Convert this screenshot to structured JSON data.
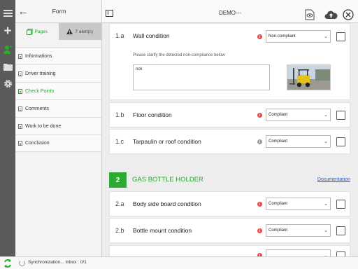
{
  "sidebar": {
    "title": "Form",
    "tabs": {
      "pages": "Pages",
      "alerts": "7 alert(s)"
    },
    "items": [
      {
        "label": "Informations"
      },
      {
        "label": "Driver training"
      },
      {
        "label": "Check Points"
      },
      {
        "label": "Comments"
      },
      {
        "label": "Work to be done"
      },
      {
        "label": "Conclusion"
      }
    ]
  },
  "header": {
    "title": "DEMO---"
  },
  "questions": [
    {
      "num": "1.a",
      "label": "Wall condition",
      "value": "Non-compliant"
    },
    {
      "num": "1.b",
      "label": "Floor condition",
      "value": "Compliant"
    },
    {
      "num": "1.c",
      "label": "Tarpaulin or roof condition",
      "value": "Compliant"
    },
    {
      "num": "2.a",
      "label": "Body side board condition",
      "value": "Compliant"
    },
    {
      "num": "2.b",
      "label": "Bottle mount condition",
      "value": "Compliant"
    }
  ],
  "clarify": {
    "prompt": "Please clarify the detected non-compliance below",
    "text": "nok"
  },
  "section": {
    "num": "2",
    "title": "GAS BOTTLE HOLDER",
    "link": "Documentation"
  },
  "footer": {
    "sync": "Synchronization... Inbox : 0/1"
  },
  "colors": {
    "accent": "#2eaa33",
    "rail": "#5a5a5a",
    "alert": "#e05050",
    "link": "#2a5db0"
  }
}
